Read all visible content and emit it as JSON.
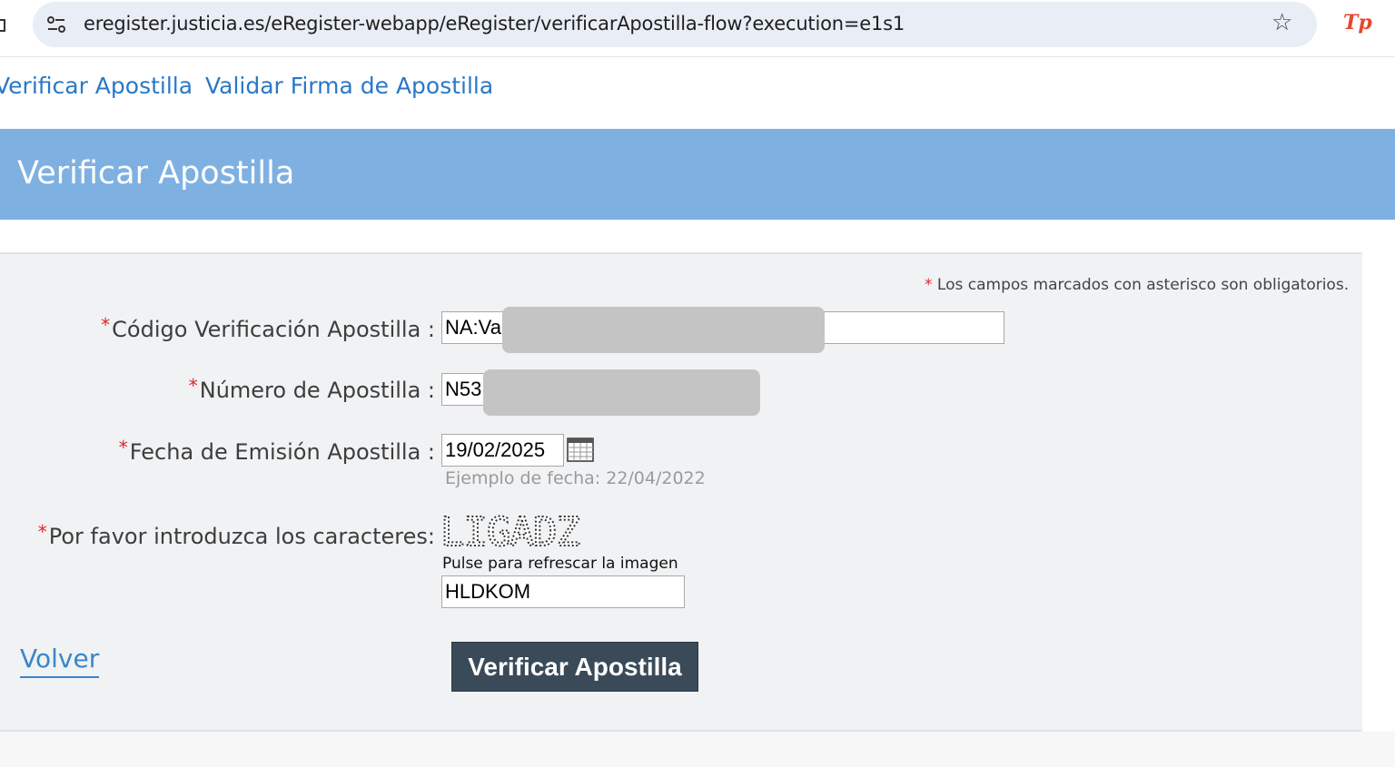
{
  "browser": {
    "url": "eregister.justicia.es/eRegister-webapp/eRegister/verificarApostilla-flow?execution=e1s1",
    "star_icon": "bookmark-star-icon",
    "extension_label": "Tp",
    "extension_color": "#e8472e"
  },
  "nav": {
    "links": [
      "Verificar Apostilla",
      "Validar Firma de Apostilla"
    ]
  },
  "banner": {
    "title": "Verificar Apostilla",
    "color": "#7eb1e1"
  },
  "form": {
    "required_note": "Los campos marcados con asterisco son obligatorios.",
    "asterisk": "*",
    "fields": [
      {
        "label": "Código Verificación Apostilla :",
        "value": "NA:Va",
        "redacted": true
      },
      {
        "label": "Número de Apostilla :",
        "value": "N53",
        "redacted": true
      },
      {
        "label": "Fecha de Emisión Apostilla :",
        "value": "19/02/2025",
        "hint": "Ejemplo de fecha: 22/04/2022",
        "icon": "calendar-icon"
      },
      {
        "label": "Por favor introduzca los caracteres:",
        "captcha_text": "LIGADZ",
        "refresh_text": "Pulse para refrescar la imagen",
        "value": "HLDKOM"
      }
    ],
    "back_link": "Volver",
    "submit_label": "Verificar Apostilla",
    "accent_color": "#e0262a"
  }
}
